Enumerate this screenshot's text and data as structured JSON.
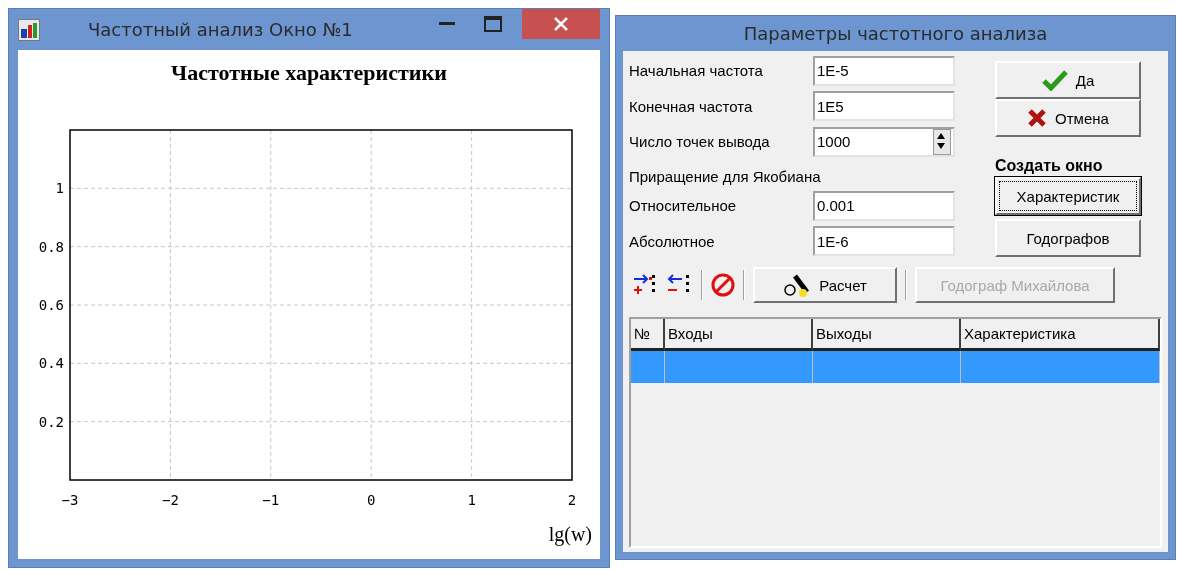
{
  "chart_window": {
    "title": "Частотный анализ Окно №1",
    "chart_data": {
      "type": "line",
      "title": "Частотные характеристики",
      "xlabel": "lg(w)",
      "xlim": [
        -3,
        2
      ],
      "ylim": [
        0,
        1.2
      ],
      "xticks": [
        -3,
        -2,
        -1,
        0,
        1,
        2
      ],
      "yticks": [
        0.2,
        0.4,
        0.6,
        0.8,
        1
      ],
      "grid": true
    }
  },
  "dialog": {
    "title": "Параметры частотного анализа",
    "fields": [
      {
        "kind": "text",
        "label": "Начальная частота",
        "value": "1E-5"
      },
      {
        "kind": "text",
        "label": "Конечная частота",
        "value": "1E5"
      },
      {
        "kind": "spin",
        "label": "Число точек вывода",
        "value": "1000"
      },
      {
        "kind": "heading",
        "label": "Приращение для Якобиана"
      },
      {
        "kind": "text",
        "label": "Относительное",
        "value": "0.001"
      },
      {
        "kind": "text",
        "label": "Абсолютное",
        "value": "1E-6"
      }
    ],
    "ok_button": "Да",
    "cancel_button": "Отмена",
    "create_window": {
      "label": "Создать окно",
      "buttons": [
        {
          "label": "Характеристик",
          "focused": true
        },
        {
          "label": "Годографов",
          "focused": false
        }
      ]
    },
    "toolbar": {
      "calc_button": "Расчет",
      "mikhailov_button": {
        "label": "Годограф Михайлова",
        "disabled": true
      }
    },
    "table": {
      "columns": [
        "№",
        "Входы",
        "Выходы",
        "Характеристика"
      ],
      "rows": [
        {
          "selected": true
        }
      ]
    }
  }
}
